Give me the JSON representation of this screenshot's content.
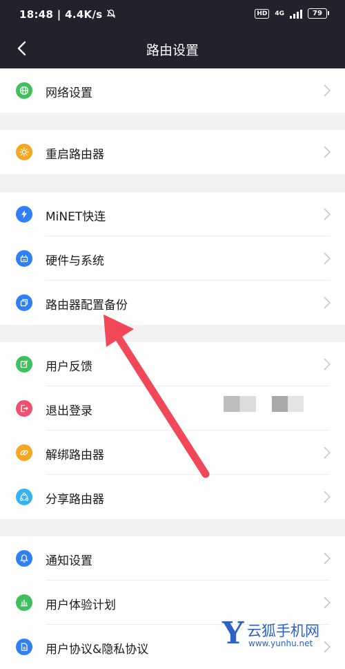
{
  "status_bar": {
    "time": "18:48",
    "network_speed": "4.4K/s",
    "hd": "HD",
    "network_type": "4G",
    "battery": "79"
  },
  "header": {
    "title": "路由设置"
  },
  "menu": [
    {
      "label": "网络设置",
      "icon": "globe-icon",
      "color": "#3ec15c"
    },
    {
      "label": "重启路由器",
      "icon": "sun-icon",
      "color": "#f5a623"
    },
    {
      "label": "MiNET快连",
      "icon": "lightning-icon",
      "color": "#2f7ff5"
    },
    {
      "label": "硬件与系统",
      "icon": "router-icon",
      "color": "#2f7ff5"
    },
    {
      "label": "路由器配置备份",
      "icon": "copy-icon",
      "color": "#2f7ff5"
    },
    {
      "label": "用户反馈",
      "icon": "edit-icon",
      "color": "#3ec15c"
    },
    {
      "label": "退出登录",
      "icon": "logout-icon",
      "color": "#f0506e"
    },
    {
      "label": "解绑路由器",
      "icon": "link-icon",
      "color": "#f5a623"
    },
    {
      "label": "分享路由器",
      "icon": "share-icon",
      "color": "#36b3f0"
    },
    {
      "label": "通知设置",
      "icon": "bell-icon",
      "color": "#2f7ff5"
    },
    {
      "label": "用户体验计划",
      "icon": "chart-icon",
      "color": "#3ec15c"
    },
    {
      "label": "用户协议&隐私协议",
      "icon": "document-icon",
      "color": "#2f7ff5"
    }
  ],
  "annotation": {
    "arrow_color": "#f04858"
  },
  "watermark": {
    "letter": "Y",
    "name": "云狐手机网",
    "url": "www.yunhu.net"
  }
}
